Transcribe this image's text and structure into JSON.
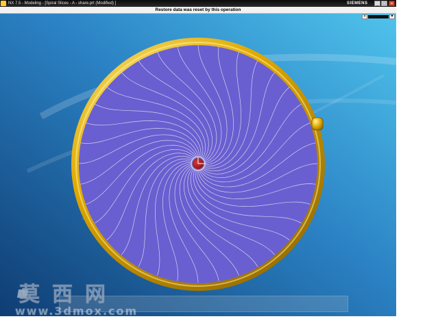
{
  "window": {
    "title": "NX 7.5 - Modeling - [Spiral Slices - A - share.prt (Modified) ]",
    "brand": "SIEMENS",
    "minimize_glyph": "_",
    "maximize_glyph": "□",
    "close_glyph": "×"
  },
  "status": {
    "message": "Restore data was reset by this operation"
  },
  "mini_toolbar": {
    "left_glyph": "«",
    "down_glyph": "▾"
  },
  "watermark": {
    "cjk": "莫西网",
    "url": "www.3dmox.com"
  },
  "colors": {
    "background_top": "#4fc3ec",
    "background_bottom": "#0f3d73",
    "disc_fill": "#6a5fd0",
    "spiral_lines": "#e8e6f5",
    "ring_gold": "#e0a800",
    "ring_highlight": "#fff39a",
    "ring_shadow": "#7a5400",
    "hub_red": "#8b0d12"
  },
  "icons": {
    "app": "nx-app-icon",
    "datum_axes": "wcs-triad-icon"
  }
}
